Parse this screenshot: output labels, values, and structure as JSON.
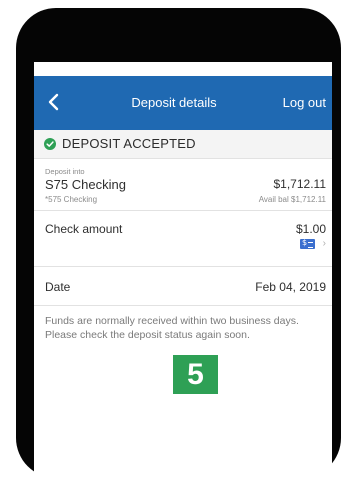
{
  "nav": {
    "title": "Deposit details",
    "logout_label": "Log out",
    "back_icon": "chevron-left-icon"
  },
  "status": {
    "icon": "check-circle-icon",
    "text": "DEPOSIT ACCEPTED",
    "color": "#2ea055"
  },
  "deposit": {
    "into_label": "Deposit into",
    "account_name": "S75 Checking",
    "account_sub": "*575 Checking",
    "balance": "$1,712.11",
    "available": "Avail bal $1,712.11"
  },
  "check": {
    "label": "Check amount",
    "amount": "$1.00",
    "image_icon": "check-image-icon",
    "chevron_icon": "chevron-right-icon"
  },
  "date": {
    "label": "Date",
    "value": "Feb 04, 2019"
  },
  "note": "Funds are normally received within two business days. Please check the deposit status again soon.",
  "badge": "5",
  "colors": {
    "nav_bar": "#1f69b2",
    "badge": "#2ea055"
  }
}
